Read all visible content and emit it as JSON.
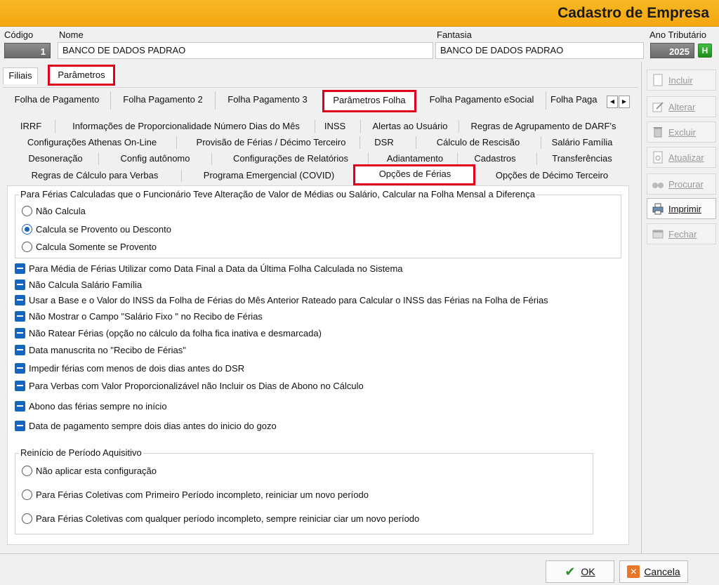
{
  "window": {
    "title": "Cadastro de Empresa"
  },
  "header": {
    "codigo_label": "Código",
    "codigo_value": "1",
    "nome_label": "Nome",
    "nome_value": "BANCO DE DADOS PADRAO",
    "fantasia_label": "Fantasia",
    "fantasia_value": "BANCO DE DADOS PADRAO",
    "ano_label": "Ano Tributário",
    "ano_value": "2025",
    "ano_btn": "H"
  },
  "top_tabs": [
    "Filiais",
    "Parâmetros"
  ],
  "sub_tabs": [
    "Folha de Pagamento",
    "Folha Pagamento 2",
    "Folha Pagamento 3",
    "Parâmetros Folha",
    "Folha Pagamento eSocial",
    "Folha Paga"
  ],
  "param_tabs": {
    "row1": [
      "IRRF",
      "Informações de Proporcionalidade Número Dias do Mês",
      "INSS",
      "Alertas ao Usuário",
      "Regras de Agrupamento de DARF's"
    ],
    "row2": [
      "Configurações Athenas On-Line",
      "Provisão de Férias / Décimo Terceiro",
      "DSR",
      "Cálculo de Rescisão",
      "Salário Família"
    ],
    "row3": [
      "Desoneração",
      "Config autônomo",
      "Configurações de Relatórios",
      "Adiantamento",
      "Cadastros",
      "Transferências"
    ],
    "row4": [
      "Regras de Cálculo para Verbas",
      "Programa Emergencial (COVID)",
      "Opções de Férias",
      "Opções de Décimo Terceiro"
    ]
  },
  "side_buttons": [
    "Incluir",
    "Alterar",
    "Excluir",
    "Atualizar",
    "Procurar",
    "Imprimir",
    "Fechar"
  ],
  "group1": {
    "title": "Para Férias Calculadas que o Funcionário Teve Alteração de Valor de Médias ou Salário, Calcular na Folha Mensal a Diferença",
    "options": [
      "Não Calcula",
      "Calcula se Provento ou Desconto",
      "Calcula Somente se Provento"
    ],
    "selected": 1
  },
  "checks": [
    "Para Média de Férias Utilizar como Data Final a Data da Última Folha Calculada no Sistema",
    "Não Calcula Salário Família",
    "Usar a Base e o Valor do INSS da Folha de Férias do Mês Anterior Rateado para Calcular o INSS das Férias na Folha de Férias",
    "Não Mostrar o Campo \"Salário Fixo \" no Recibo de Férias",
    "Não Ratear Férias (opção no cálculo da folha fica inativa e desmarcada)",
    "Data manuscrita no \"Recibo de Férias\"",
    "Impedir férias com menos de dois dias antes do DSR",
    "Para Verbas com Valor Proporcionalizável não Incluir os Dias de Abono no Cálculo",
    "Abono das férias sempre no início",
    "Data de pagamento sempre dois dias antes do inicio do gozo"
  ],
  "group2": {
    "title": "Reinício de Período Aquisitivo",
    "options": [
      "Não aplicar esta configuração",
      "Para Férias Coletivas com  Primeiro Período incompleto, reiniciar um novo período",
      "Para Férias Coletivas com  qualquer período incompleto, sempre reiniciar ciar um novo período"
    ]
  },
  "footer": {
    "ok": "OK",
    "cancel": "Cancela"
  },
  "colors": {
    "accent": "#f4a70f",
    "highlight": "#e0001b",
    "check": "#1565c0"
  }
}
